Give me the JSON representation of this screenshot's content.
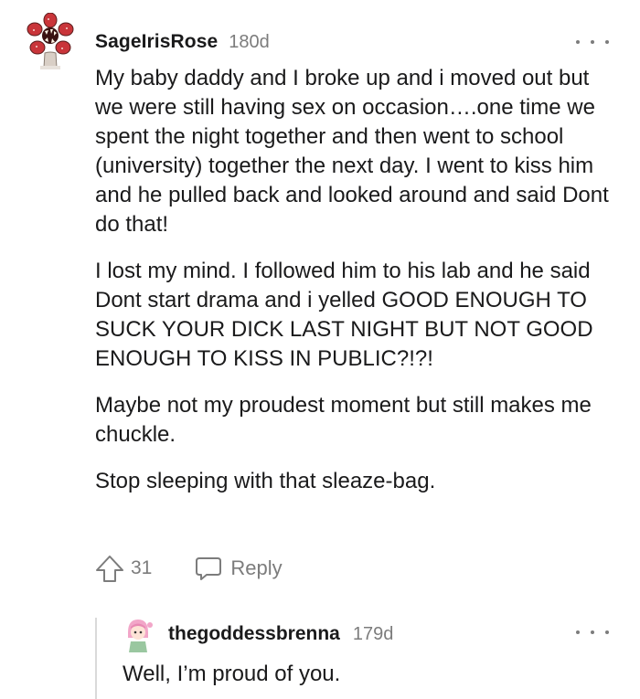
{
  "comment": {
    "username": "SageIrisRose",
    "age": "180d",
    "avatar": "demogorgon-flower-avatar",
    "paragraphs": [
      "My baby daddy and I broke up and i moved out but we were still having sex on occasion….one time we spent the night together and then went to school (university) together the next day. I went to kiss him and he pulled back and looked around and said Dont do that!",
      "I lost my mind. I followed him to his lab and he said Dont start drama and i yelled GOOD ENOUGH TO SUCK YOUR DICK LAST NIGHT BUT NOT GOOD ENOUGH TO KISS IN PUBLIC?!?!",
      "Maybe not my proudest moment but still makes me chuckle.",
      "Stop sleeping with that sleaze-bag."
    ],
    "votes": "31",
    "reply_label": "Reply",
    "more_icon": "more-options-icon",
    "upvote_icon": "upvote-arrow-icon",
    "reply_icon": "speech-bubble-icon"
  },
  "reply": {
    "username": "thegoddessbrenna",
    "age": "179d",
    "avatar": "pink-haired-avatar",
    "text": "Well, I’m proud of you.",
    "more_icon": "more-options-icon"
  },
  "colors": {
    "text_primary": "#1a1a1b",
    "text_secondary": "#7c7c7c",
    "thread_line": "#dadada",
    "avatar_red": "#c9353a",
    "avatar_pink": "#f2a6c8"
  }
}
